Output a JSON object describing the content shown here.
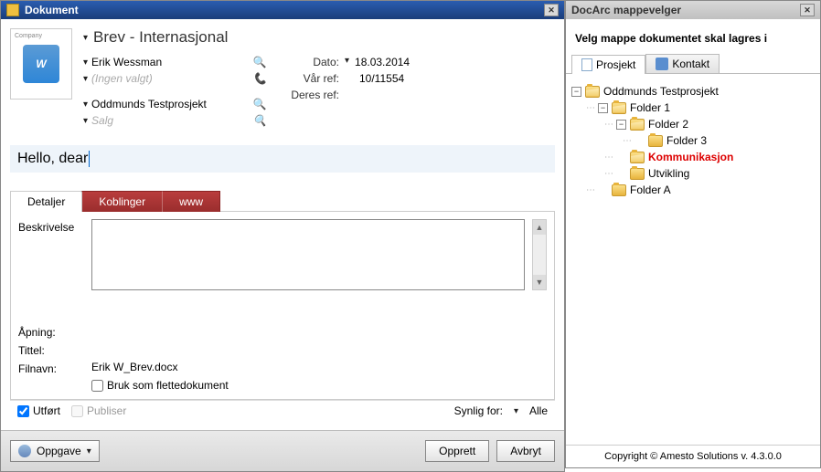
{
  "left": {
    "title": "Dokument",
    "docIcon": {
      "company": "Company",
      "letter": "W"
    },
    "docType": "Brev - Internasjonal",
    "person": "Erik Wessman",
    "contactPlaceholder": "(Ingen valgt)",
    "project": "Oddmunds Testprosjekt",
    "salesPlaceholder": "Salg",
    "dateLabel": "Dato:",
    "dateValue": "18.03.2014",
    "ourRefLabel": "Vår ref:",
    "ourRefValue": "10/11554",
    "theirRefLabel": "Deres ref:",
    "theirRefValue": "",
    "subject": "Hello, dear",
    "tabs": {
      "details": "Detaljer",
      "links": "Koblinger",
      "www": "www"
    },
    "details": {
      "descLabel": "Beskrivelse",
      "openingLabel": "Åpning:",
      "titleLabel": "Tittel:",
      "filenameLabel": "Filnavn:",
      "filenameValue": "Erik W_Brev.docx",
      "mergeLabel": "Bruk som flettedokument"
    },
    "footer": {
      "done": "Utført",
      "publish": "Publiser",
      "visibleForLabel": "Synlig for:",
      "visibleForValue": "Alle"
    },
    "buttons": {
      "task": "Oppgave",
      "create": "Opprett",
      "cancel": "Avbryt"
    }
  },
  "right": {
    "title": "DocArc mappevelger",
    "heading": "Velg mappe dokumentet skal lagres i",
    "tabs": {
      "project": "Prosjekt",
      "contact": "Kontakt"
    },
    "tree": {
      "root": "Oddmunds Testprosjekt",
      "f1": "Folder 1",
      "f2": "Folder 2",
      "f3": "Folder 3",
      "comm": "Kommunikasjon",
      "dev": "Utvikling",
      "fa": "Folder A"
    },
    "copyright": "Copyright © Amesto Solutions v. 4.3.0.0"
  }
}
